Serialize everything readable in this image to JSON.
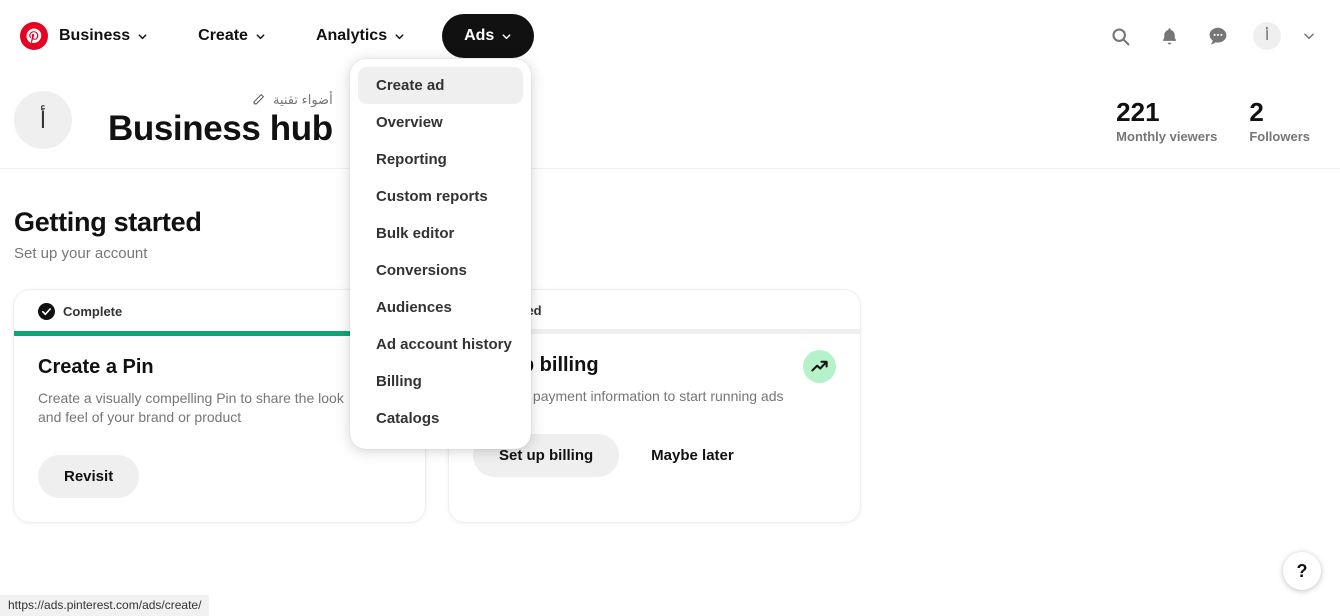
{
  "nav": {
    "logo_icon": "pinterest-logo-icon",
    "items": [
      {
        "label": "Business",
        "has_chevron": true,
        "active": false
      },
      {
        "label": "Create",
        "has_chevron": true,
        "active": false
      },
      {
        "label": "Analytics",
        "has_chevron": true,
        "active": false
      },
      {
        "label": "Ads",
        "has_chevron": true,
        "active": true
      }
    ],
    "right_icons": [
      "search-icon",
      "bell-icon",
      "chat-icon"
    ],
    "avatar_initial": "أ"
  },
  "dropdown": {
    "open_for": "Ads",
    "items": [
      {
        "label": "Create ad",
        "hovered": true
      },
      {
        "label": "Overview",
        "hovered": false
      },
      {
        "label": "Reporting",
        "hovered": false
      },
      {
        "label": "Custom reports",
        "hovered": false
      },
      {
        "label": "Bulk editor",
        "hovered": false
      },
      {
        "label": "Conversions",
        "hovered": false
      },
      {
        "label": "Audiences",
        "hovered": false
      },
      {
        "label": "Ad account history",
        "hovered": false
      },
      {
        "label": "Billing",
        "hovered": false
      },
      {
        "label": "Catalogs",
        "hovered": false
      }
    ]
  },
  "profile": {
    "avatar_initial": "أ",
    "account_name": "أضواء تقنية",
    "edit_icon": "pencil-icon",
    "title": "Business hub",
    "stats": [
      {
        "value": "221",
        "label": "Monthly viewers"
      },
      {
        "value": "2",
        "label": "Followers"
      }
    ]
  },
  "getting_started": {
    "title": "Getting started",
    "subtitle": "Set up your account",
    "cards": [
      {
        "status_label": "Complete",
        "status_icon": "check-circle-icon",
        "progress_percent": 100,
        "title": "Create a Pin",
        "description": "Create a visually compelling Pin to share the look and feel of your brand or product",
        "primary_button": "Revisit",
        "secondary_button": null,
        "corner_icon": null
      },
      {
        "status_label": "Not started",
        "status_icon": null,
        "progress_percent": 0,
        "title": "Set up billing",
        "description": "Add your payment information to start running ads",
        "primary_button": "Set up billing",
        "secondary_button": "Maybe later",
        "corner_icon": "trending-up-icon"
      }
    ]
  },
  "help": {
    "label": "?"
  },
  "status_bar": {
    "url": "https://ads.pinterest.com/ads/create/"
  },
  "colors": {
    "brand_red": "#e60023",
    "accent_green": "#0fa573",
    "icon_bg_green": "#b5f2ca",
    "neutral_bg": "#efefef",
    "text_primary": "#111111",
    "text_secondary": "#767676"
  }
}
